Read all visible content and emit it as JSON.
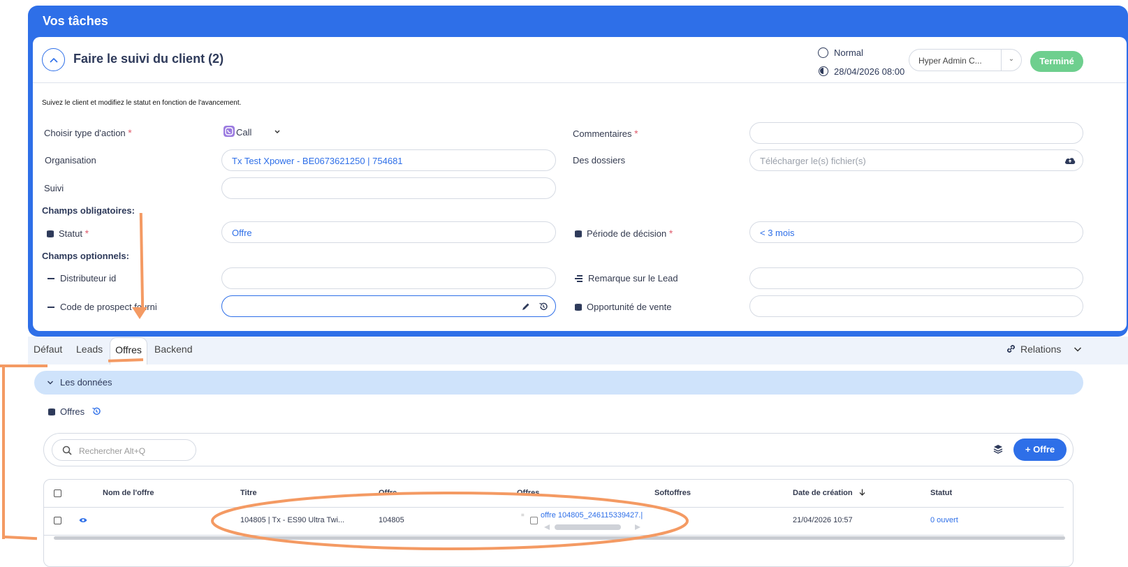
{
  "panel": {
    "title": "Vos tâches"
  },
  "task": {
    "title": "Faire le suivi du client (2)",
    "priority": "Normal",
    "due": "28/04/2026 08:00",
    "assignee": "Hyper Admin C...",
    "done_label": "Terminé",
    "hint": "Suivez le client et modifiez le statut en fonction de l'avancement."
  },
  "form": {
    "action_type_label": "Choisir type d'action",
    "action_type_value": "Call",
    "comments_label": "Commentaires",
    "organisation_label": "Organisation",
    "organisation_value": "Tx Test Xpower - BE0673621250 | 754681",
    "dossiers_label": "Des dossiers",
    "dossiers_placeholder": "Télécharger le(s) fichier(s)",
    "suivi_label": "Suivi",
    "mandatory_title": "Champs obligatoires:",
    "statut_label": "Statut",
    "statut_value": "Offre",
    "decision_label": "Période de décision",
    "decision_value": "< 3 mois",
    "optional_title": "Champs optionnels:",
    "distributeur_label": "Distributeur id",
    "remarque_label": "Remarque sur le Lead",
    "code_label": "Code de prospect fourni",
    "opportunite_label": "Opportunité de vente",
    "required_mark": "*"
  },
  "tabs": {
    "items": [
      "Défaut",
      "Leads",
      "Offres",
      "Backend"
    ],
    "active": "Offres",
    "relations": "Relations"
  },
  "section": {
    "title": "Les données",
    "list_label": "Offres",
    "search_placeholder": "Rechercher Alt+Q",
    "add_label": "+ Offre"
  },
  "table": {
    "columns": [
      "Nom de l'offre",
      "Titre",
      "Offre",
      "Offres",
      "Softoffres",
      "Date de création",
      "Statut"
    ],
    "rows": [
      {
        "nom": "",
        "titre": "104805 | Tx - ES90 Ultra Twi...",
        "offre": "104805",
        "offres": "offre 104805_246115339427.|",
        "softoffres": "",
        "date": "21/04/2026 10:57",
        "statut": "0 ouvert"
      }
    ]
  },
  "colors": {
    "primary": "#2e6fe8",
    "success": "#6ecf8e",
    "annotation": "#f49a63",
    "accordion": "#cfe3fb"
  },
  "icons": [
    "chevron-up-icon",
    "phone-icon",
    "chevron-down-icon",
    "upload-cloud-icon",
    "database-icon",
    "dash-icon",
    "lines-icon",
    "pencil-icon",
    "history-icon",
    "link-icon",
    "search-icon",
    "layers-icon",
    "eye-icon",
    "sort-arrow-icon"
  ]
}
